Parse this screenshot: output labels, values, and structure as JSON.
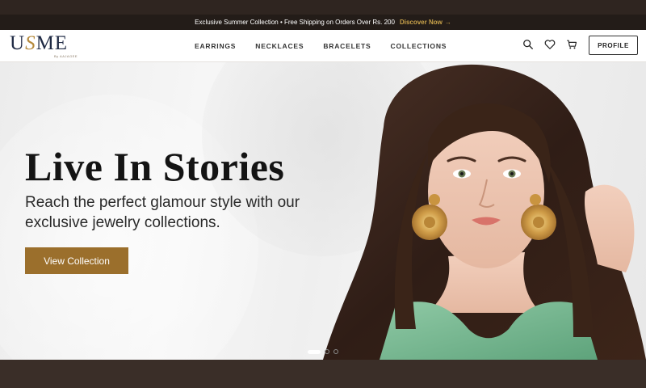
{
  "announcement": {
    "text": "Exclusive Summer Collection • Free Shipping on Orders Over Rs. 200",
    "link_label": "Discover Now",
    "link_arrow": "→"
  },
  "brand": {
    "logo_part1": "U",
    "logo_swirl": "S",
    "logo_part2": "ME",
    "logo_sub": "By AAJAGEE"
  },
  "nav": {
    "items": [
      {
        "label": "EARRINGS"
      },
      {
        "label": "NECKLACES"
      },
      {
        "label": "BRACELETS"
      },
      {
        "label": "COLLECTIONS"
      }
    ]
  },
  "header_icons": [
    "search-icon",
    "heart-icon",
    "cart-icon"
  ],
  "profile_label": "PROFILE",
  "hero": {
    "title": "Live In Stories",
    "subtitle": "Reach the perfect glamour style with our exclusive jewelry collections.",
    "cta_label": "View Collection",
    "slides_total": 3,
    "active_slide": 1
  },
  "colors": {
    "accent": "#9b6f2c",
    "announce_link": "#c8a24a",
    "brand_navy": "#1f2a44",
    "dark_bg": "#3a2e28"
  }
}
